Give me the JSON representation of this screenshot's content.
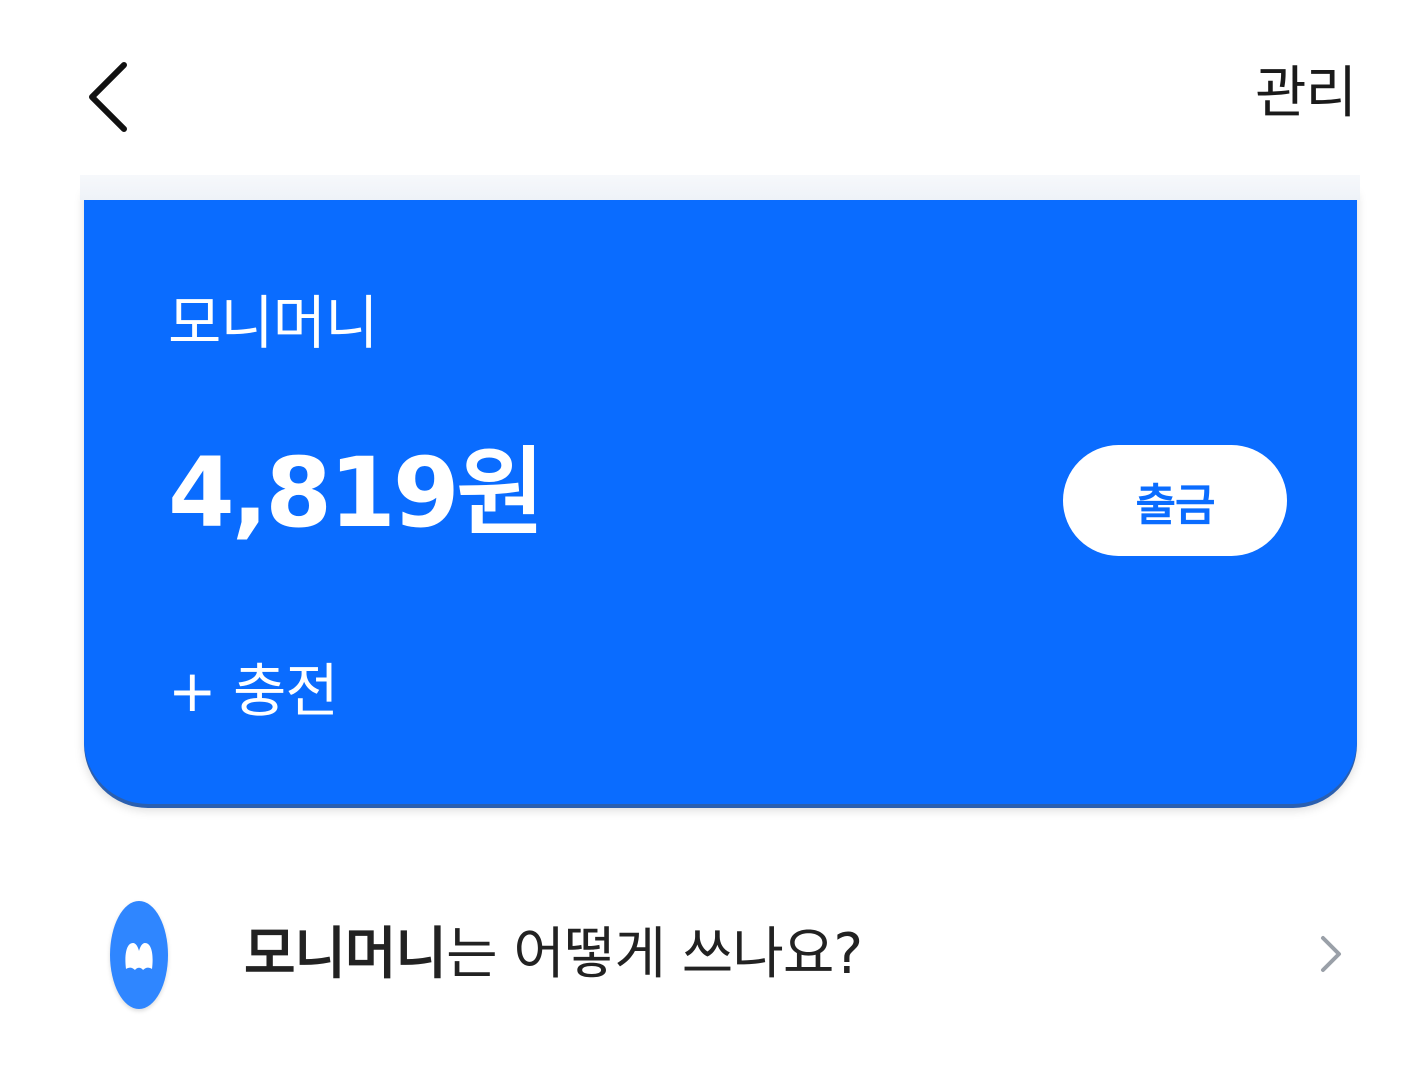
{
  "header": {
    "back_icon": "chevron-left-icon",
    "manage_label": "관리"
  },
  "wallet": {
    "title": "모니머니",
    "balance": "4,819원",
    "withdraw_label": "출금",
    "charge_label": "+ 충전",
    "card_color": "#0a6cff"
  },
  "help": {
    "logo_icon": "monimoney-logo-icon",
    "question_bold": "모니머니",
    "question_rest": "는 어떻게 쓰나요?",
    "chevron_icon": "chevron-right-icon"
  }
}
